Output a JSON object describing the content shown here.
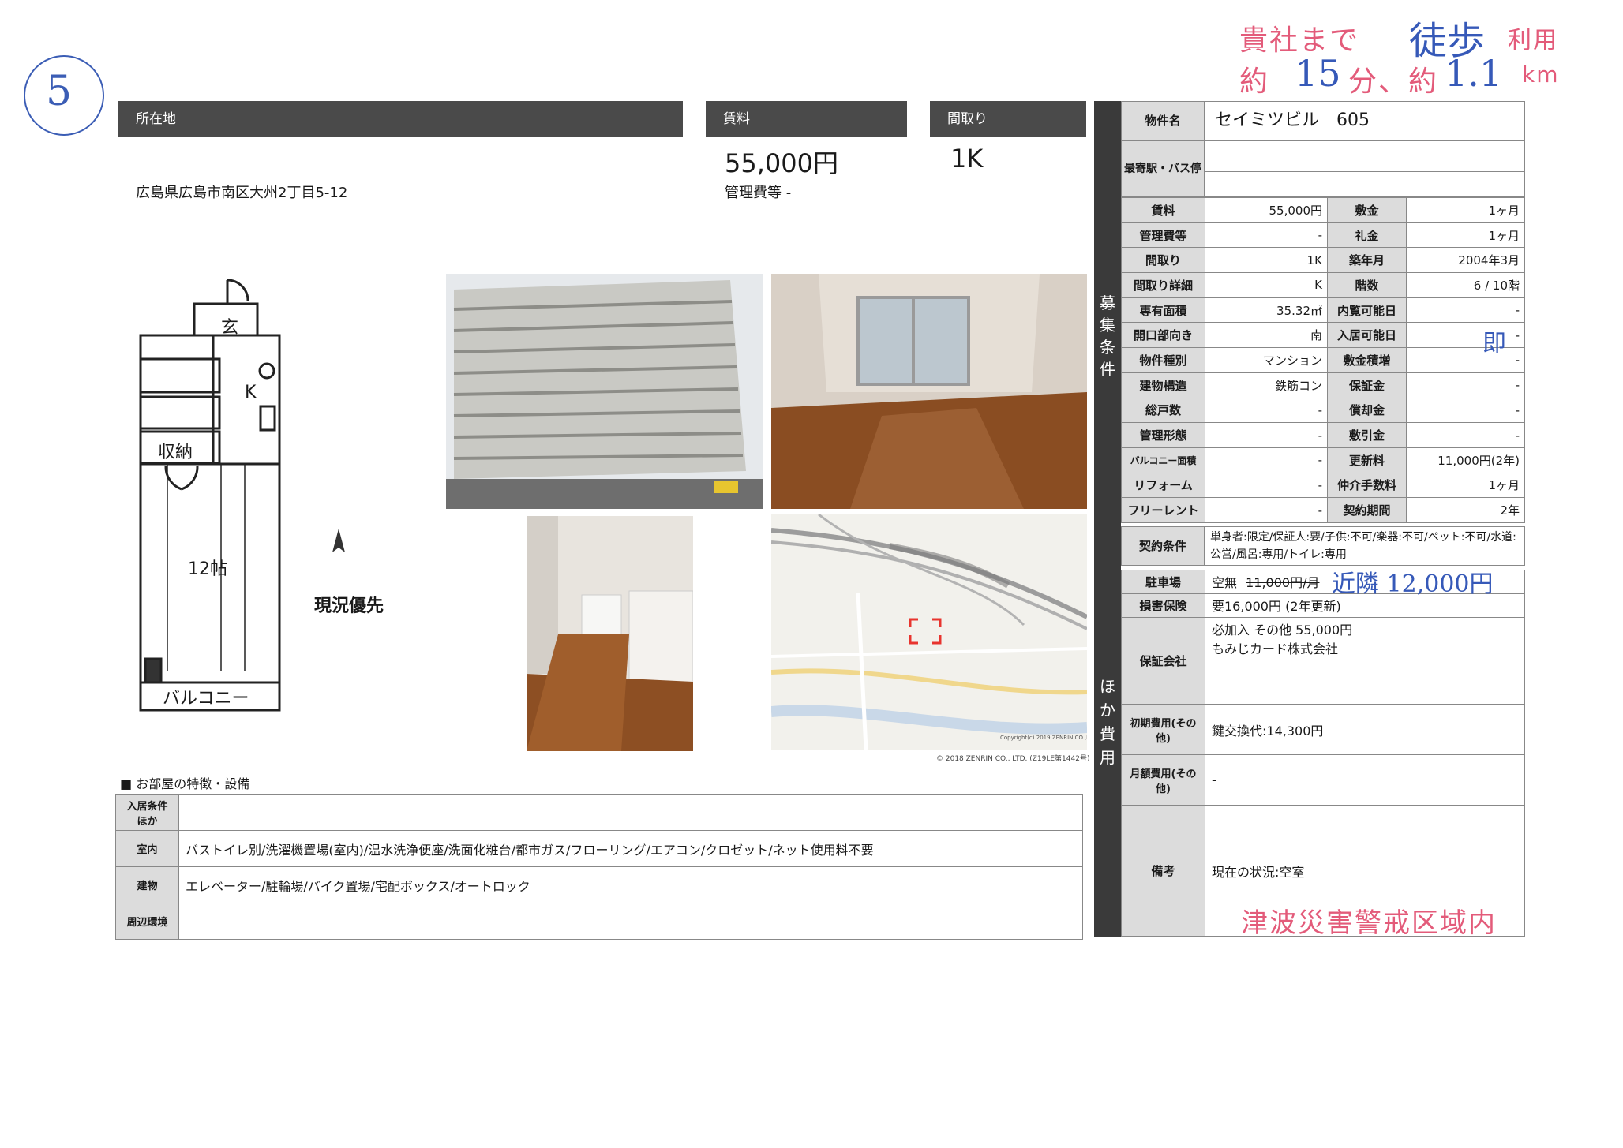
{
  "annotations": {
    "circled_number": "5",
    "stamp_line1_prefix": "貴社まで",
    "stamp_line1_hand": "徒歩",
    "stamp_line1_suffix": "利用",
    "stamp_line2_prefix": "約",
    "stamp_line2_minutes": "15",
    "stamp_line2_mid": "分、約",
    "stamp_line2_km": "1.1",
    "stamp_line2_suffix": "km",
    "move_in_hand": "即",
    "parking_hand": "近隣 12,000円",
    "tsunami_stamp": "津波災害警戒区域内"
  },
  "headers": {
    "location": "所在地",
    "rent": "賃料",
    "layout": "間取り"
  },
  "summary": {
    "address": "広島県広島市南区大州2丁目5-12",
    "rent": "55,000円",
    "management_fee": "管理費等 -",
    "layout": "1K"
  },
  "floorplan": {
    "entrance": "玄",
    "kitchen": "K",
    "storage": "収納",
    "room": "12帖",
    "balcony": "バルコニー",
    "priority_note": "現況優先"
  },
  "map": {
    "copyright1": "Copyright(c) 2019 ZENRIN CO.,LTD.",
    "copyright2": "© 2018 ZENRIN CO., LTD. (Z19LE第1442号)"
  },
  "property": {
    "name_label": "物件名",
    "name": "セイミツビル　605",
    "station_label": "最寄駅・バス停",
    "station": ""
  },
  "conditions": {
    "sidebar": [
      "募",
      "集",
      "条",
      "件"
    ],
    "rows": [
      {
        "l1": "賃料",
        "v1": "55,000円",
        "l2": "敷金",
        "v2": "1ヶ月"
      },
      {
        "l1": "管理費等",
        "v1": "-",
        "l2": "礼金",
        "v2": "1ヶ月"
      },
      {
        "l1": "間取り",
        "v1": "1K",
        "l2": "築年月",
        "v2": "2004年3月"
      },
      {
        "l1": "間取り詳細",
        "v1": "K",
        "l2": "階数",
        "v2": "6 / 10階"
      },
      {
        "l1": "専有面積",
        "v1": "35.32㎡",
        "l2": "内覧可能日",
        "v2": "-"
      },
      {
        "l1": "開口部向き",
        "v1": "南",
        "l2": "入居可能日",
        "v2": "-"
      },
      {
        "l1": "物件種別",
        "v1": "マンション",
        "l2": "敷金積増",
        "v2": "-"
      },
      {
        "l1": "建物構造",
        "v1": "鉄筋コン",
        "l2": "保証金",
        "v2": "-"
      },
      {
        "l1": "総戸数",
        "v1": "-",
        "l2": "償却金",
        "v2": "-"
      },
      {
        "l1": "管理形態",
        "v1": "-",
        "l2": "敷引金",
        "v2": "-"
      },
      {
        "l1": "バルコニー面積",
        "v1": "-",
        "l2": "更新料",
        "v2": "11,000円(2年)"
      },
      {
        "l1": "リフォーム",
        "v1": "-",
        "l2": "仲介手数料",
        "v2": "1ヶ月"
      },
      {
        "l1": "フリーレント",
        "v1": "-",
        "l2": "契約期間",
        "v2": "2年"
      }
    ],
    "contract_label": "契約条件",
    "contract_value": "単身者:限定/保証人:要/子供:不可/楽器:不可/ペット:不可/水道:公営/風呂:専用/トイレ:専用"
  },
  "costs": {
    "sidebar": [
      "ほ",
      "か",
      "費",
      "用"
    ],
    "parking_label": "駐車場",
    "parking_prefix": "空無",
    "parking_struck": "11,000円/月",
    "insurance_label": "損害保険",
    "insurance": "要16,000円 (2年更新)",
    "guarantee_label": "保証会社",
    "guarantee_line1": "必加入 その他 55,000円",
    "guarantee_line2": "もみじカード株式会社",
    "initial_label": "初期費用(その他)",
    "initial": "鍵交換代:14,300円",
    "monthly_label": "月額費用(その他)",
    "monthly": "-",
    "remarks_label": "備考",
    "remarks": "現在の状況:空室"
  },
  "features": {
    "heading": "■ お部屋の特徴・設備",
    "rows": [
      {
        "label": "入居条件ほか",
        "value": ""
      },
      {
        "label": "室内",
        "value": "バストイレ別/洗濯機置場(室内)/温水洗浄便座/洗面化粧台/都市ガス/フローリング/エアコン/クロゼット/ネット使用料不要"
      },
      {
        "label": "建物",
        "value": "エレベーター/駐輪場/バイク置場/宅配ボックス/オートロック"
      },
      {
        "label": "周辺環境",
        "value": ""
      }
    ]
  }
}
